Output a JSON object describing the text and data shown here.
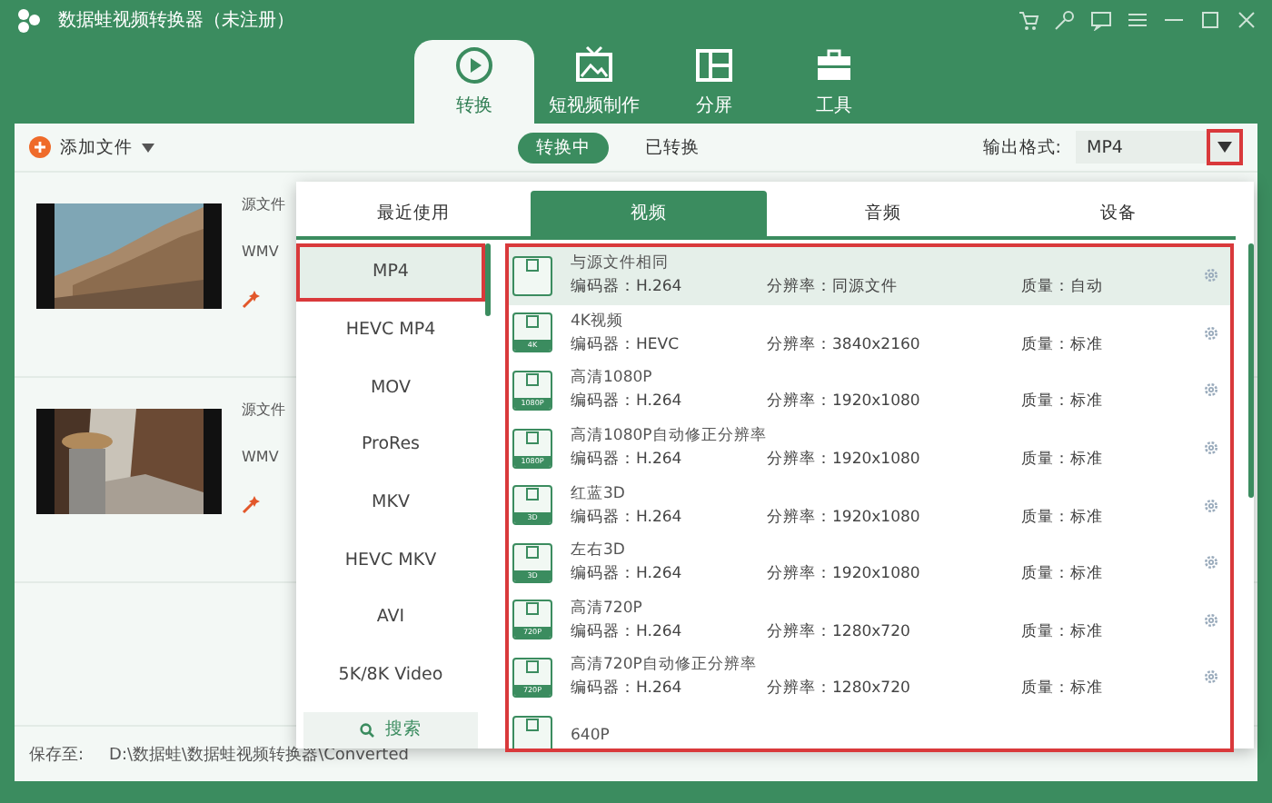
{
  "window": {
    "title": "数据蛙视频转换器（未注册）"
  },
  "nav_tabs": [
    {
      "label": "转换",
      "selected": true
    },
    {
      "label": "短视频制作",
      "selected": false
    },
    {
      "label": "分屏",
      "selected": false
    },
    {
      "label": "工具",
      "selected": false
    }
  ],
  "toolbar": {
    "add_files": "添加文件",
    "segments": [
      {
        "label": "转换中",
        "selected": true
      },
      {
        "label": "已转换",
        "selected": false
      }
    ],
    "output_label": "输出格式:",
    "output_value": "MP4"
  },
  "files": [
    {
      "source_label": "源文件",
      "format": "WMV"
    },
    {
      "source_label": "源文件",
      "format": "WMV"
    }
  ],
  "format_panel": {
    "tabs": [
      {
        "label": "最近使用",
        "selected": false
      },
      {
        "label": "视频",
        "selected": true
      },
      {
        "label": "音频",
        "selected": false
      },
      {
        "label": "设备",
        "selected": false
      }
    ],
    "formats": [
      {
        "label": "MP4",
        "selected": true
      },
      {
        "label": "HEVC MP4",
        "selected": false
      },
      {
        "label": "MOV",
        "selected": false
      },
      {
        "label": "ProRes",
        "selected": false
      },
      {
        "label": "MKV",
        "selected": false
      },
      {
        "label": "HEVC MKV",
        "selected": false
      },
      {
        "label": "AVI",
        "selected": false
      },
      {
        "label": "5K/8K Video",
        "selected": false
      }
    ],
    "search": "搜索",
    "presets": [
      {
        "name": "与源文件相同",
        "encoder": "编码器：H.264",
        "resolution": "分辨率：同源文件",
        "quality": "质量：自动",
        "selected": true
      },
      {
        "name": "4K视频",
        "badge": "4K",
        "encoder": "编码器：HEVC",
        "resolution": "分辨率：3840x2160",
        "quality": "质量：标准",
        "selected": false
      },
      {
        "name": "高清1080P",
        "badge": "1080P",
        "encoder": "编码器：H.264",
        "resolution": "分辨率：1920x1080",
        "quality": "质量：标准",
        "selected": false
      },
      {
        "name": "高清1080P自动修正分辨率",
        "badge": "1080P",
        "encoder": "编码器：H.264",
        "resolution": "分辨率：1920x1080",
        "quality": "质量：标准",
        "selected": false
      },
      {
        "name": "红蓝3D",
        "badge": "3D",
        "encoder": "编码器：H.264",
        "resolution": "分辨率：1920x1080",
        "quality": "质量：标准",
        "selected": false
      },
      {
        "name": "左右3D",
        "badge": "3D",
        "encoder": "编码器：H.264",
        "resolution": "分辨率：1920x1080",
        "quality": "质量：标准",
        "selected": false
      },
      {
        "name": "高清720P",
        "badge": "720P",
        "encoder": "编码器：H.264",
        "resolution": "分辨率：1280x720",
        "quality": "质量：标准",
        "selected": false
      },
      {
        "name": "高清720P自动修正分辨率",
        "badge": "720P",
        "encoder": "编码器：H.264",
        "resolution": "分辨率：1280x720",
        "quality": "质量：标准",
        "selected": false
      },
      {
        "name": "640P",
        "selected": false
      }
    ]
  },
  "bottom_bar": {
    "save_label": "保存至:",
    "save_path": "D:\\数据蛙\\数据蛙视频转换器\\Converted"
  }
}
